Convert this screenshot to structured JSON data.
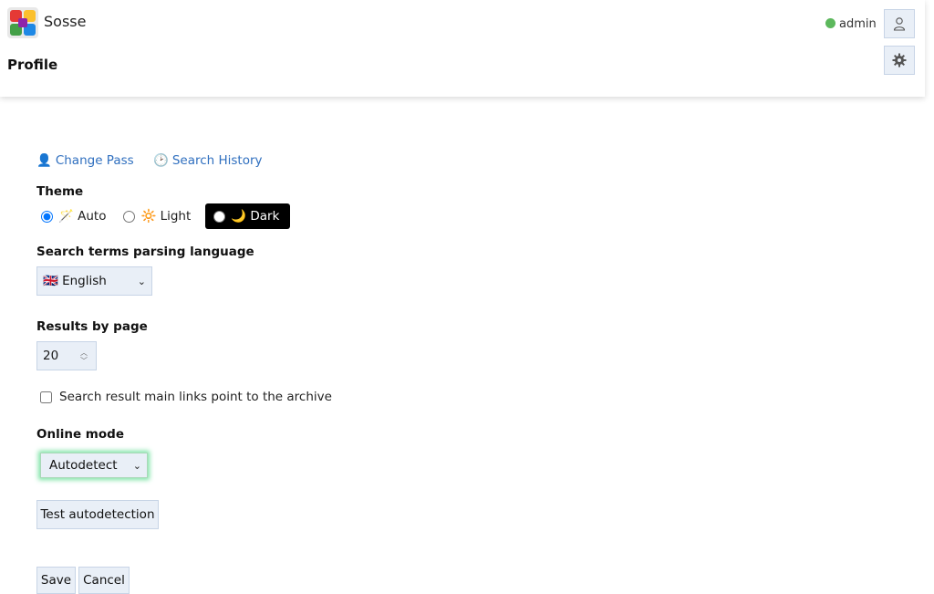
{
  "header": {
    "app_title": "Sosse",
    "page_title": "Profile",
    "username": "admin",
    "status_color": "#5cb85c",
    "user_icon": "user-icon",
    "settings_icon": "gear-icon"
  },
  "links": {
    "change_pass": {
      "glyph": "👤",
      "label": "Change Pass"
    },
    "search_history": {
      "glyph": "🕑",
      "label": "Search History"
    }
  },
  "theme": {
    "label": "Theme",
    "options": [
      {
        "glyph": "🪄",
        "label": "Auto",
        "selected": true
      },
      {
        "glyph": "🔆",
        "label": "Light",
        "selected": false
      },
      {
        "glyph": "🌙",
        "label": "Dark",
        "selected": false
      }
    ]
  },
  "language": {
    "label": "Search terms parsing language",
    "selected": "🇬🇧 English"
  },
  "results": {
    "label": "Results by page",
    "value": "20"
  },
  "archive_links": {
    "label": "Search result main links point to the archive",
    "checked": false
  },
  "online_mode": {
    "label": "Online mode",
    "selected": "Autodetect"
  },
  "buttons": {
    "test": "Test autodetection",
    "save": "Save",
    "cancel": "Cancel"
  },
  "colors": {
    "accent_link": "#2f6fbf",
    "input_bg": "#e9eff7",
    "focus_glow": "#7de3a6"
  }
}
